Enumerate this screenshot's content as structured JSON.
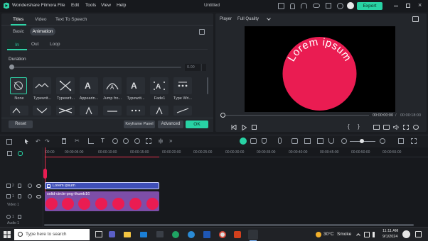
{
  "app": {
    "name": "Wondershare Filmora",
    "menu": [
      "File",
      "Edit",
      "Tools",
      "View",
      "Help"
    ],
    "doc_title": "Untitled",
    "export_label": "Export"
  },
  "left_panel": {
    "tabs": [
      "Titles",
      "Video",
      "Text To Speech"
    ],
    "subtabs": [
      "Basic",
      "Animation"
    ],
    "anim_tabs": [
      "In",
      "Out",
      "Loop"
    ],
    "duration_label": "Duration",
    "duration_value": "0.00",
    "presets": [
      "None",
      "Typewrit...",
      "Typewrit...",
      "Appearin...",
      "Jump fro...",
      "Typewrit...",
      "Fade1",
      "Type Wri..."
    ],
    "reset_label": "Reset",
    "keyframe_label": "Keyframe Panel",
    "advanced_label": "Advanced",
    "ok_label": "OK"
  },
  "player": {
    "label": "Player",
    "quality": "Full Quality",
    "preview_text": "Lorem ipsum",
    "current_time": "00:00:00:00",
    "total_time": "00:00:18:00",
    "colors": {
      "circle": "#ea1c52",
      "text": "#ffffff"
    }
  },
  "timeline": {
    "ruler": [
      "00:00",
      "00:00:05:00",
      "00:00:10:00",
      "00:00:15:00",
      "00:00:20:00",
      "00:00:25:00",
      "00:00:30:00",
      "00:00:35:00",
      "00:00:40:00",
      "00:00:45:00",
      "00:00:50:00",
      "00:00:55:00"
    ],
    "tracks": [
      {
        "num": "2",
        "label": ""
      },
      {
        "num": "1",
        "label": "Video 1"
      },
      {
        "num": "1",
        "label": "Audio 1"
      }
    ],
    "title_clip_label": "Lorem ipsum",
    "video_clip_label": "solid-circle-png-thumb16"
  },
  "taskbar": {
    "search_placeholder": "Type here to search",
    "weather_temp": "30°C",
    "weather_desc": "Smoke",
    "time": "11:11 AM",
    "date": "9/1/2024"
  }
}
